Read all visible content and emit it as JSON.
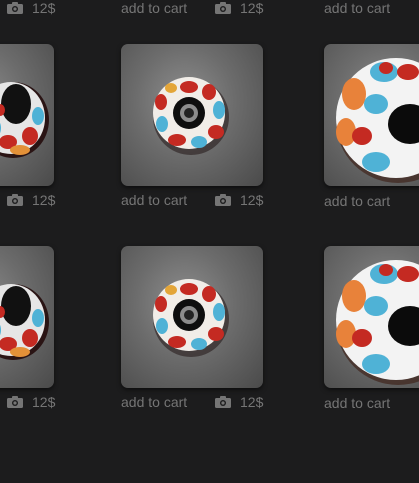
{
  "products": [
    {
      "price": "12$",
      "add_to_cart": "add to cart",
      "camera_icon": "camera-icon",
      "bead": "bead-side"
    },
    {
      "price": "12$",
      "add_to_cart": "add to cart",
      "camera_icon": "camera-icon",
      "bead": "bead-top"
    },
    {
      "price": "",
      "add_to_cart": "add to cart",
      "camera_icon": "",
      "bead": "bead-big"
    },
    {
      "price": "12$",
      "add_to_cart": "add to cart",
      "camera_icon": "camera-icon",
      "bead": "bead-side"
    },
    {
      "price": "12$",
      "add_to_cart": "add to cart",
      "camera_icon": "camera-icon",
      "bead": "bead-top"
    },
    {
      "price": "",
      "add_to_cart": "add to cart",
      "camera_icon": "",
      "bead": "bead-big"
    }
  ],
  "top_row": [
    {
      "price": "12$",
      "add_to_cart": "add to cart"
    },
    {
      "price": "12$",
      "add_to_cart": "add to cart"
    }
  ],
  "colors": {
    "background": "#1c1c1d",
    "text": "#757575",
    "bead_red": "#c42a22",
    "bead_blue": "#4fb2d6"
  }
}
